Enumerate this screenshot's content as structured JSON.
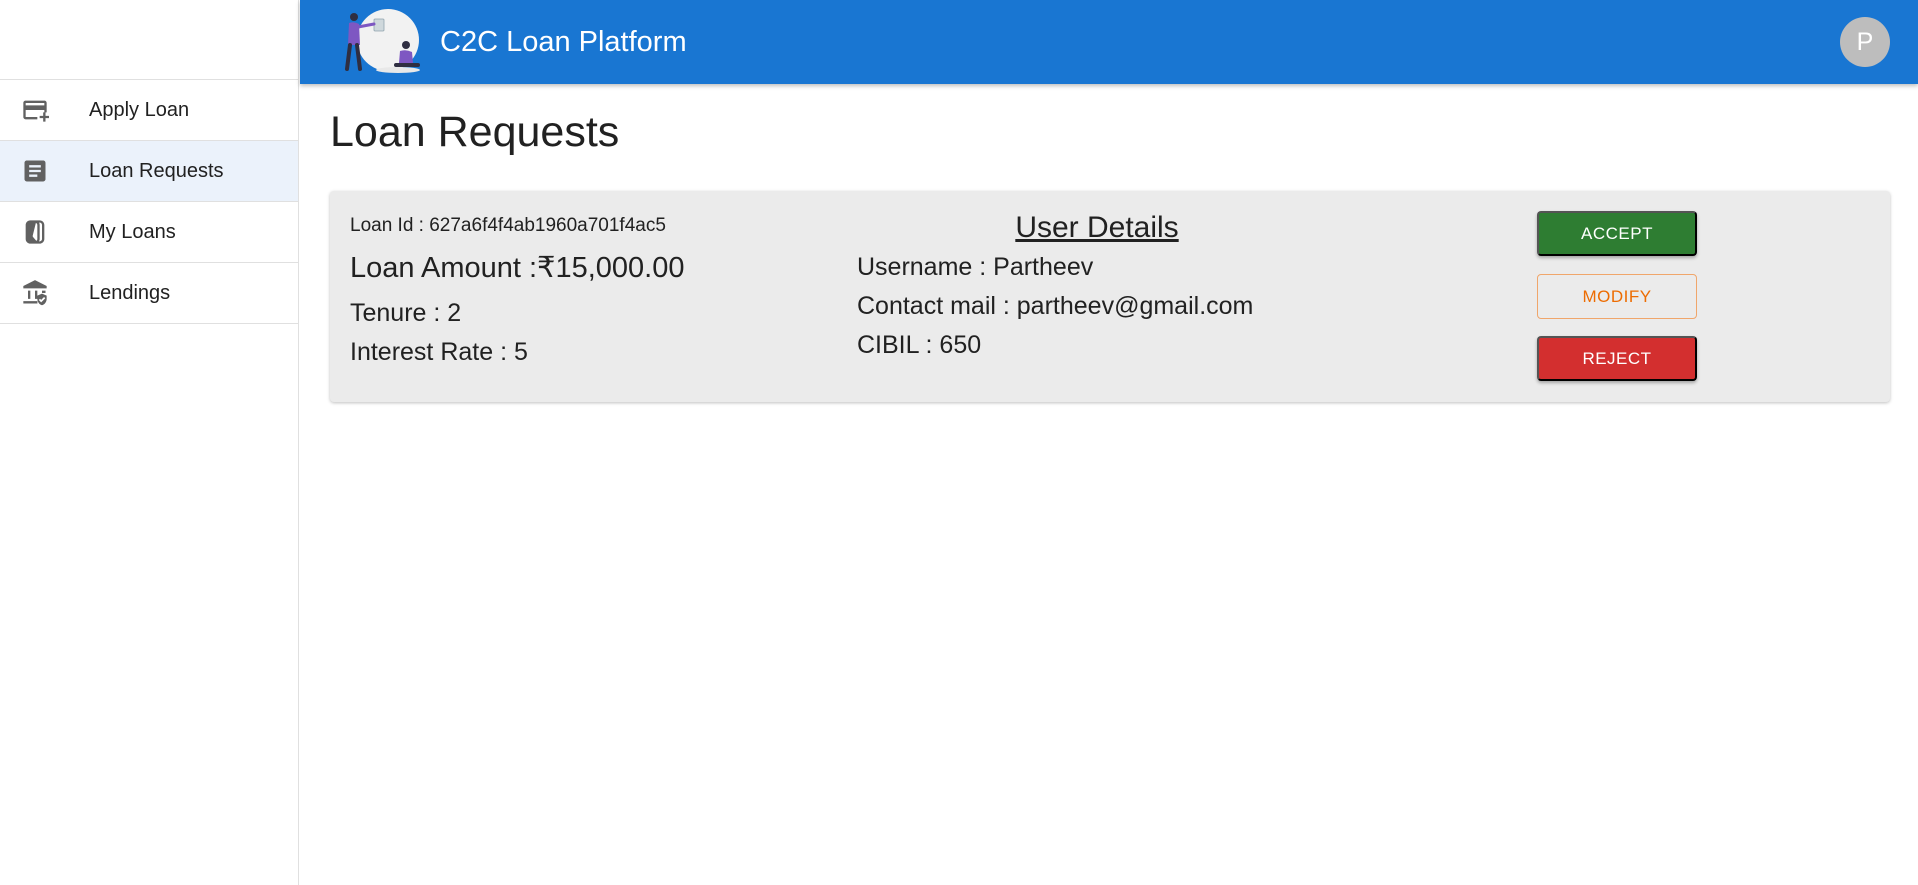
{
  "app": {
    "title": "C2C Loan Platform",
    "avatar_initial": "P"
  },
  "sidebar": {
    "items": [
      {
        "label": "Apply Loan",
        "icon": "add-card-icon",
        "active": false
      },
      {
        "label": "Loan Requests",
        "icon": "article-icon",
        "active": true
      },
      {
        "label": "My Loans",
        "icon": "wallet-icon",
        "active": false
      },
      {
        "label": "Lendings",
        "icon": "bank-icon",
        "active": false
      }
    ]
  },
  "page": {
    "title": "Loan Requests"
  },
  "request": {
    "loan_id": "Loan Id : 627a6f4f4ab1960a701f4ac5",
    "loan_amount": "Loan Amount :₹15,000.00",
    "tenure": "Tenure : 2",
    "interest_rate": "Interest Rate : 5",
    "user_details_title": "User Details",
    "username": "Username : Partheev",
    "contact_mail": "Contact mail : partheev@gmail.com",
    "cibil": "CIBIL : 650",
    "accept_label": "ACCEPT",
    "modify_label": "MODIFY",
    "reject_label": "REJECT"
  },
  "colors": {
    "primary": "#1976d2",
    "success": "#2e7d32",
    "warning": "#ed6c02",
    "error": "#d32f2f",
    "active_nav": "#ebf2fb"
  }
}
